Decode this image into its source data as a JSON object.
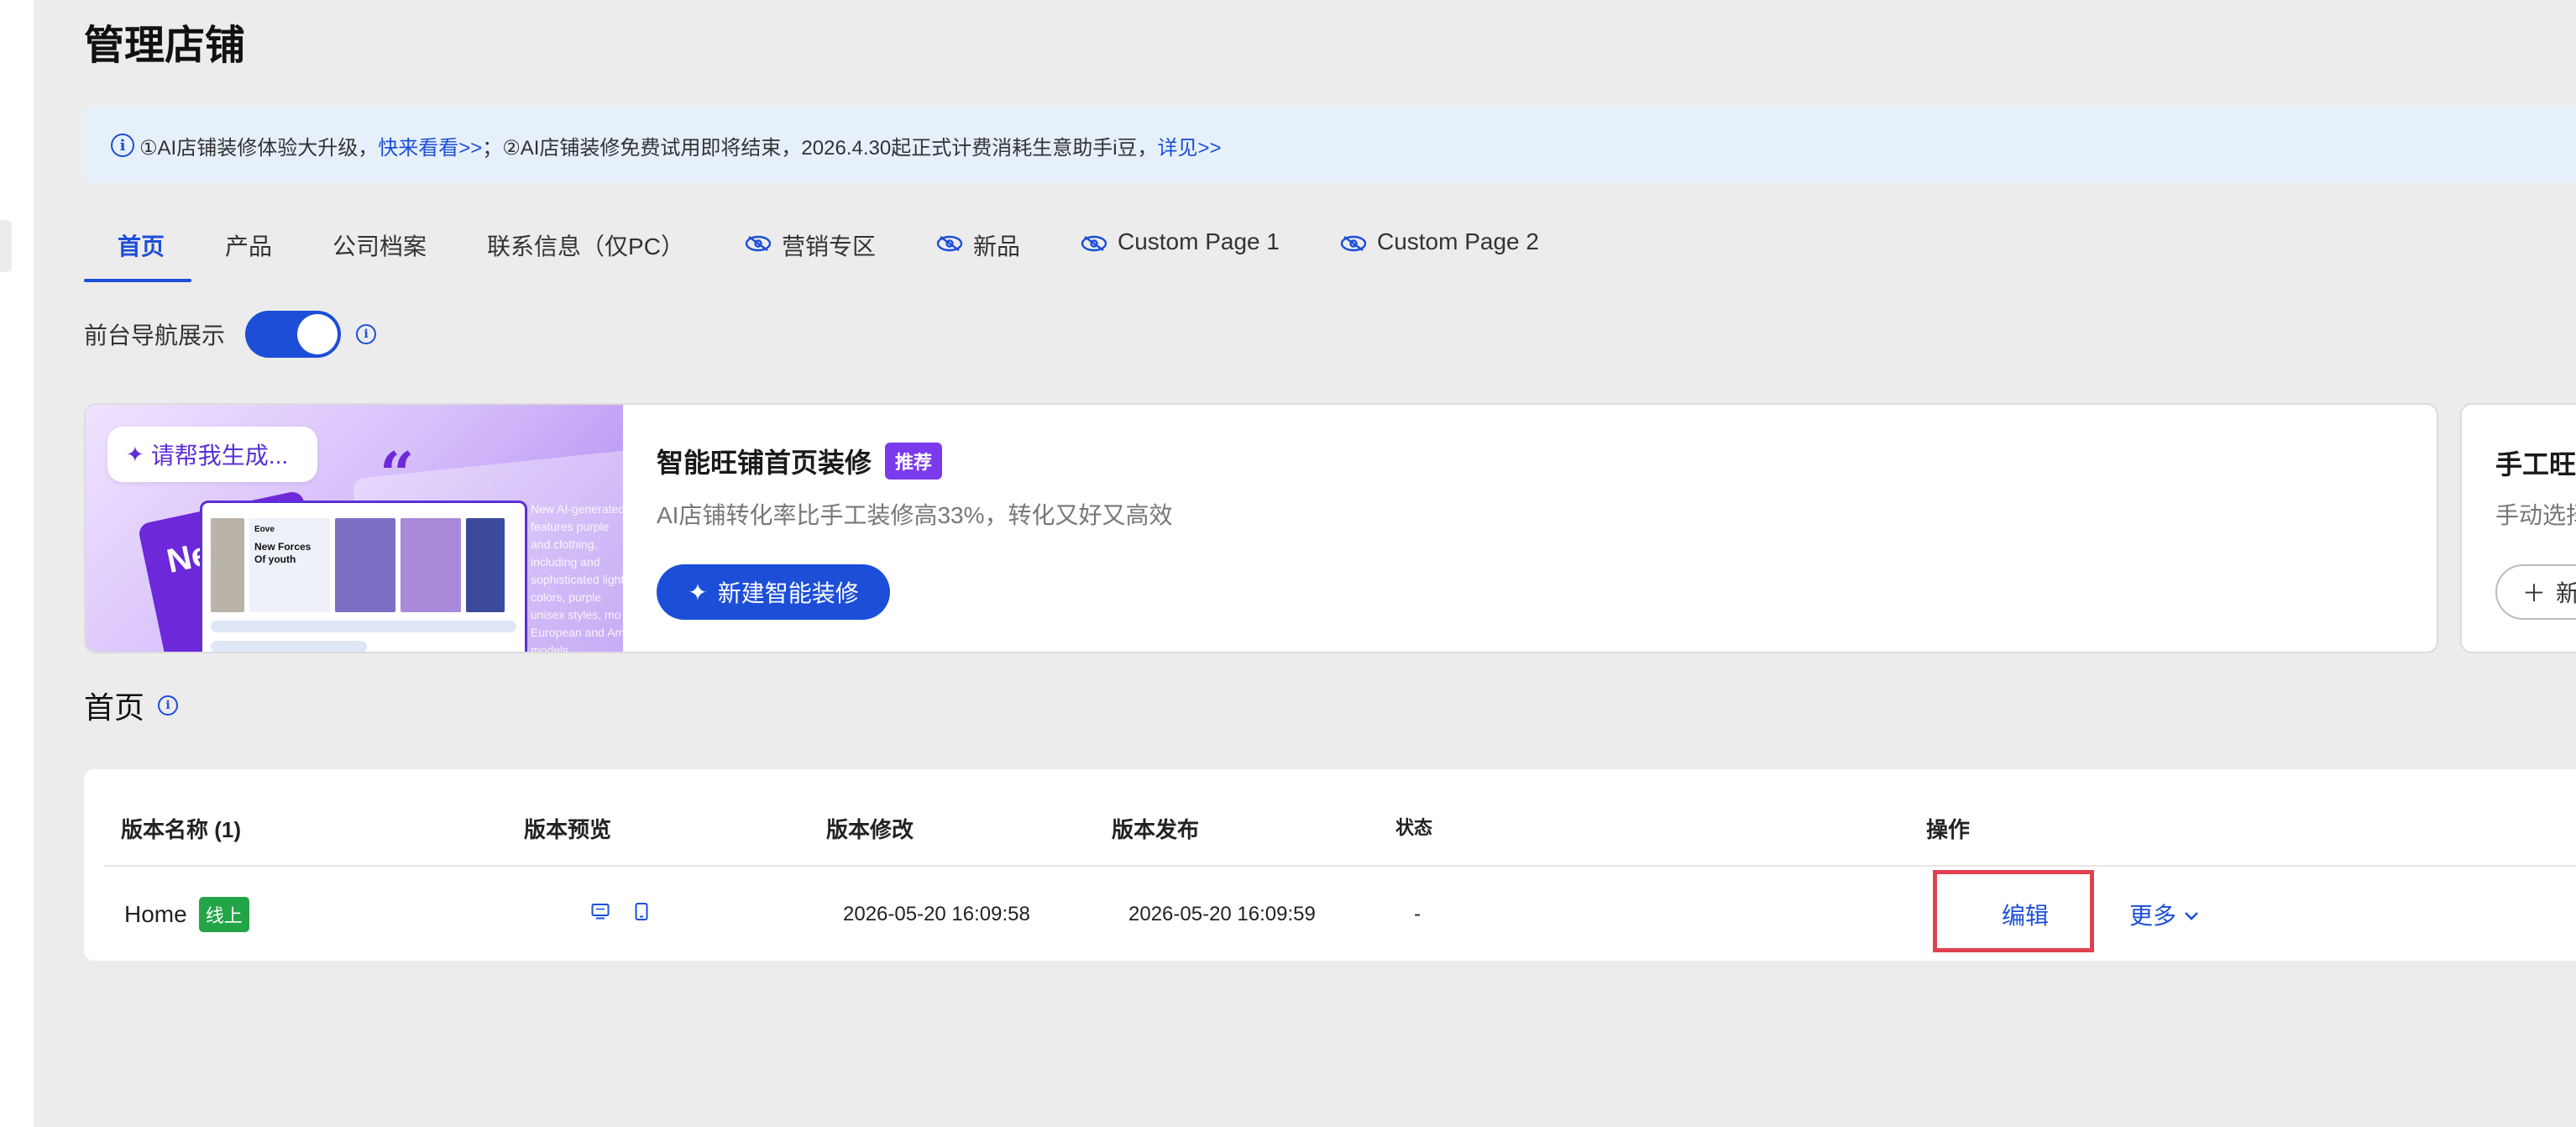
{
  "page": {
    "title": "管理店铺"
  },
  "notice": {
    "part1": "①AI店铺装修体验大升级，",
    "link1": "快来看看>>",
    "part2": "；②AI店铺装修免费试用即将结束，2026.4.30起正式计费消耗生意助手i豆，",
    "link2": "详见>>"
  },
  "tabs": [
    {
      "label": "首页",
      "active": true,
      "hidden_icon": false
    },
    {
      "label": "产品",
      "active": false,
      "hidden_icon": false
    },
    {
      "label": "公司档案",
      "active": false,
      "hidden_icon": false
    },
    {
      "label": "联系信息（仅PC）",
      "active": false,
      "hidden_icon": false
    },
    {
      "label": "营销专区",
      "active": false,
      "hidden_icon": true
    },
    {
      "label": "新品",
      "active": false,
      "hidden_icon": true
    },
    {
      "label": "Custom Page 1",
      "active": false,
      "hidden_icon": true
    },
    {
      "label": "Custom Page 2",
      "active": false,
      "hidden_icon": true
    }
  ],
  "nav_toggle": {
    "label": "前台导航展示",
    "on": true
  },
  "ai_card": {
    "prompt": "请帮我生成...",
    "title": "智能旺铺首页装修",
    "badge": "推荐",
    "desc": "AI店铺转化率比手工装修高33%，转化又好又高效",
    "button": "新建智能装修",
    "visual": {
      "card_text": "New Ho",
      "brand": "Eove",
      "banner_line1": "New Forces",
      "banner_line2": "Of youth",
      "faded_text": "New AI-generated features purple and clothing, including and sophisticated light colors, purple unisex styles, mo European and Am models."
    }
  },
  "manual_card": {
    "title": "手工旺",
    "desc": "手动选择",
    "button": "新"
  },
  "section": {
    "title": "首页"
  },
  "table": {
    "headers": {
      "name": "版本名称 (1)",
      "preview": "版本预览",
      "modified": "版本修改",
      "published": "版本发布",
      "status": "状态",
      "actions": "操作"
    },
    "rows": [
      {
        "name": "Home",
        "badge": "线上",
        "modified": "2026-05-20 16:09:58",
        "published": "2026-05-20 16:09:59",
        "status": "-",
        "edit": "编辑",
        "more": "更多"
      }
    ]
  },
  "colors": {
    "accent": "#1d4ed8",
    "online_badge": "#22a447",
    "recommend_badge": "#7c3aed",
    "highlight_box": "#e0414f",
    "notice_bg": "#e6f0fb"
  }
}
